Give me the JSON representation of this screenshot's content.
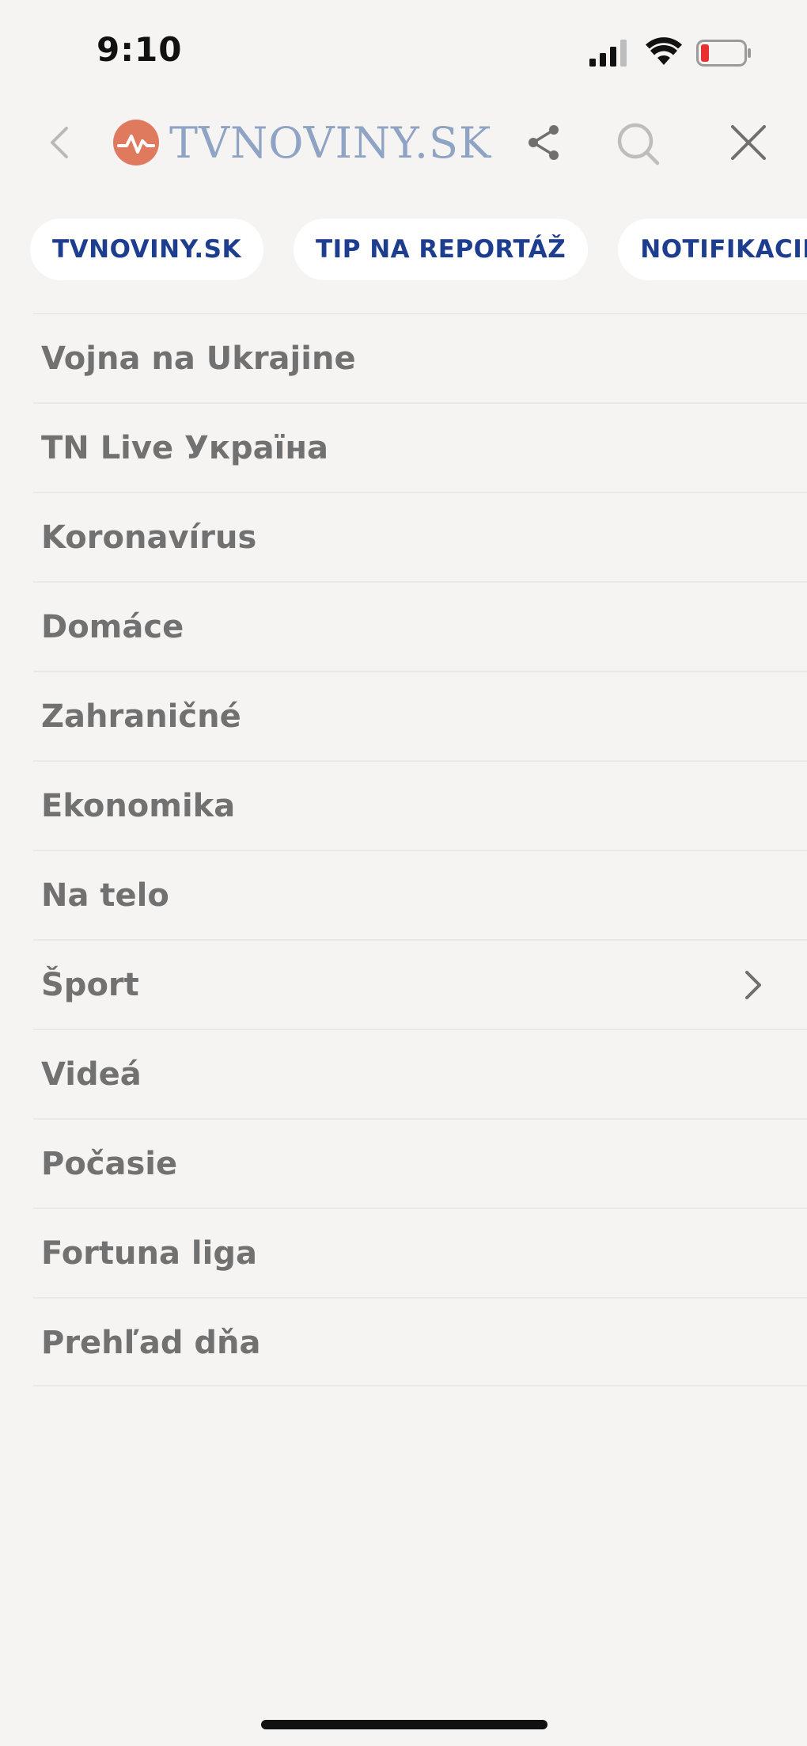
{
  "status_bar": {
    "time": "9:10",
    "signal_icon": "cellular-signal-icon",
    "wifi_icon": "wifi-icon",
    "battery_icon": "battery-low-icon",
    "battery_color": "#e8302f"
  },
  "header": {
    "back_icon": "chevron-left-icon",
    "logo_text_main": "TVNOVINY",
    "logo_text_suffix": ".SK",
    "logo_color": "#8fa3c4",
    "logo_mark_color": "#e07a5f",
    "share_icon": "share-icon",
    "search_icon": "search-icon",
    "close_icon": "close-icon"
  },
  "chips": [
    {
      "label": "TVNOVINY.SK"
    },
    {
      "label": "TIP NA REPORTÁŽ"
    },
    {
      "label": "NOTIFIKACIE"
    }
  ],
  "chip_text_color": "#1d3d8f",
  "menu": {
    "items": [
      {
        "label": "Vojna na Ukrajine"
      },
      {
        "label": "TN Live Україна"
      },
      {
        "label": "Koronavírus"
      },
      {
        "label": "Domáce"
      },
      {
        "label": "Zahraničné"
      },
      {
        "label": "Ekonomika"
      },
      {
        "label": "Na telo"
      },
      {
        "label": "Šport",
        "has_submenu": true
      },
      {
        "label": "Videá"
      },
      {
        "label": "Počasie"
      },
      {
        "label": "Fortuna liga"
      },
      {
        "label": "Prehľad dňa"
      }
    ]
  }
}
